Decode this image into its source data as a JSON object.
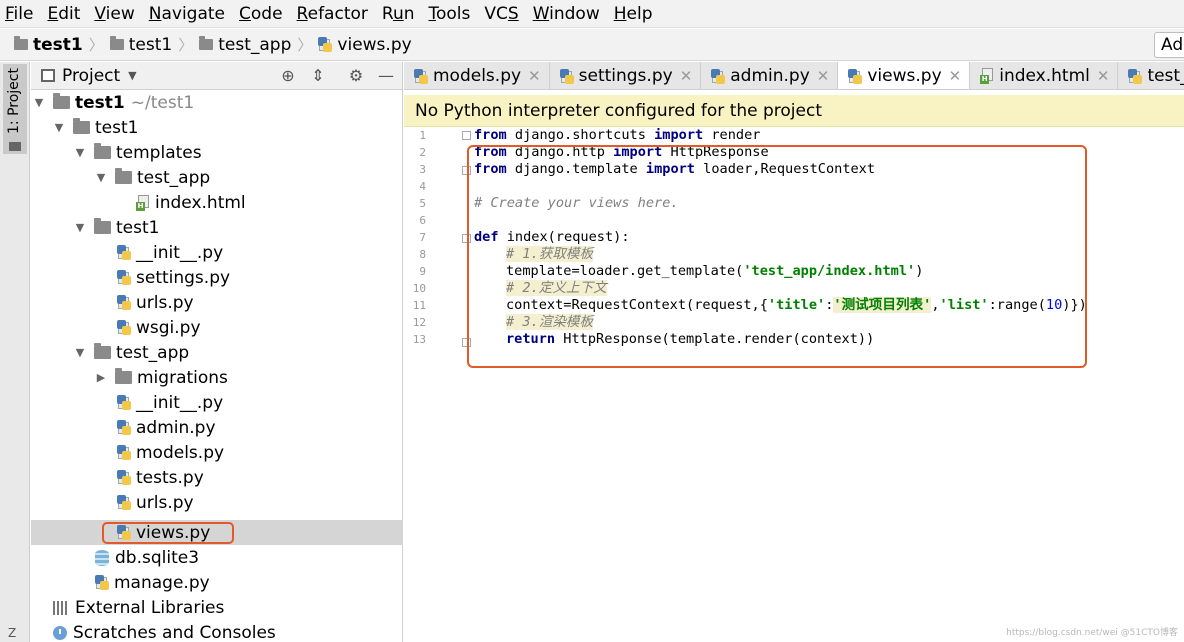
{
  "menu": [
    {
      "pre": "",
      "u": "F",
      "post": "ile"
    },
    {
      "pre": "",
      "u": "E",
      "post": "dit"
    },
    {
      "pre": "",
      "u": "V",
      "post": "iew"
    },
    {
      "pre": "",
      "u": "N",
      "post": "avigate"
    },
    {
      "pre": "",
      "u": "C",
      "post": "ode"
    },
    {
      "pre": "",
      "u": "R",
      "post": "efactor"
    },
    {
      "pre": "R",
      "u": "u",
      "post": "n"
    },
    {
      "pre": "",
      "u": "T",
      "post": "ools"
    },
    {
      "pre": "VC",
      "u": "S",
      "post": ""
    },
    {
      "pre": "",
      "u": "W",
      "post": "indow"
    },
    {
      "pre": "",
      "u": "H",
      "post": "elp"
    }
  ],
  "breadcrumb": {
    "root": "test1",
    "folder1": "test1",
    "folder2": "test_app",
    "file": "views.py",
    "right_button": "Ad"
  },
  "left_strip": {
    "project_tab": "1: Project",
    "bottom_tab": "Z"
  },
  "project_panel": {
    "title": "Project",
    "root_name": "test1",
    "root_path": "~/test1",
    "items": {
      "test1_inner": "test1",
      "templates": "templates",
      "templates_test_app": "test_app",
      "index_html": "index.html",
      "test1_pkg": "test1",
      "init1": "__init__.py",
      "settings": "settings.py",
      "urls1": "urls.py",
      "wsgi": "wsgi.py",
      "test_app": "test_app",
      "migrations": "migrations",
      "init2": "__init__.py",
      "admin": "admin.py",
      "models": "models.py",
      "tests": "tests.py",
      "urls2": "urls.py",
      "views": "views.py",
      "db": "db.sqlite3",
      "manage": "manage.py",
      "ext_libs": "External Libraries",
      "scratches": "Scratches and Consoles"
    }
  },
  "tabs": [
    {
      "label": "models.py",
      "type": "py",
      "active": false
    },
    {
      "label": "settings.py",
      "type": "py",
      "active": false
    },
    {
      "label": "admin.py",
      "type": "py",
      "active": false
    },
    {
      "label": "views.py",
      "type": "py",
      "active": true
    },
    {
      "label": "index.html",
      "type": "html",
      "active": false
    },
    {
      "label": "test_app/u",
      "type": "py",
      "active": false
    }
  ],
  "banner": "No Python interpreter configured for the project",
  "code": {
    "line_numbers": [
      "1",
      "2",
      "3",
      "4",
      "5",
      "6",
      "7",
      "8",
      "9",
      "10",
      "11",
      "12",
      "13"
    ],
    "l1": {
      "k1": "from",
      "a": " django.shortcuts ",
      "k2": "import",
      "b": " render"
    },
    "l2": {
      "k1": "from",
      "a": " django.http ",
      "k2": "import",
      "b": " HttpResponse"
    },
    "l3": {
      "k1": "from",
      "a": " django.template ",
      "k2": "import",
      "b": " loader,RequestContext"
    },
    "l5": "# Create your views here.",
    "l7": {
      "k1": "def",
      "a": " index(request):"
    },
    "l8": "# 1.获取模板",
    "l9": {
      "a": "template=loader.get_template(",
      "s": "'test_app/index.html'",
      "b": ")"
    },
    "l10": "# 2.定义上下文",
    "l11": {
      "a": "context=RequestContext(request,{",
      "s1": "'title'",
      "c": ":",
      "s2": "'测试项目列表'",
      "d": ",",
      "s3": "'list'",
      "e": ":range(",
      "n": "10",
      "f": ")})"
    },
    "l12": "# 3.渲染模板",
    "l13": {
      "k1": "return",
      "a": " HttpResponse(template.render(context))"
    }
  },
  "watermark": "https://blog.csdn.net/wei @51CTO博客",
  "colors": {
    "annotation_box": "#e05a2a",
    "banner_bg": "#f9f3c4",
    "keyword": "#000080",
    "string": "#008000",
    "comment": "#808080"
  }
}
